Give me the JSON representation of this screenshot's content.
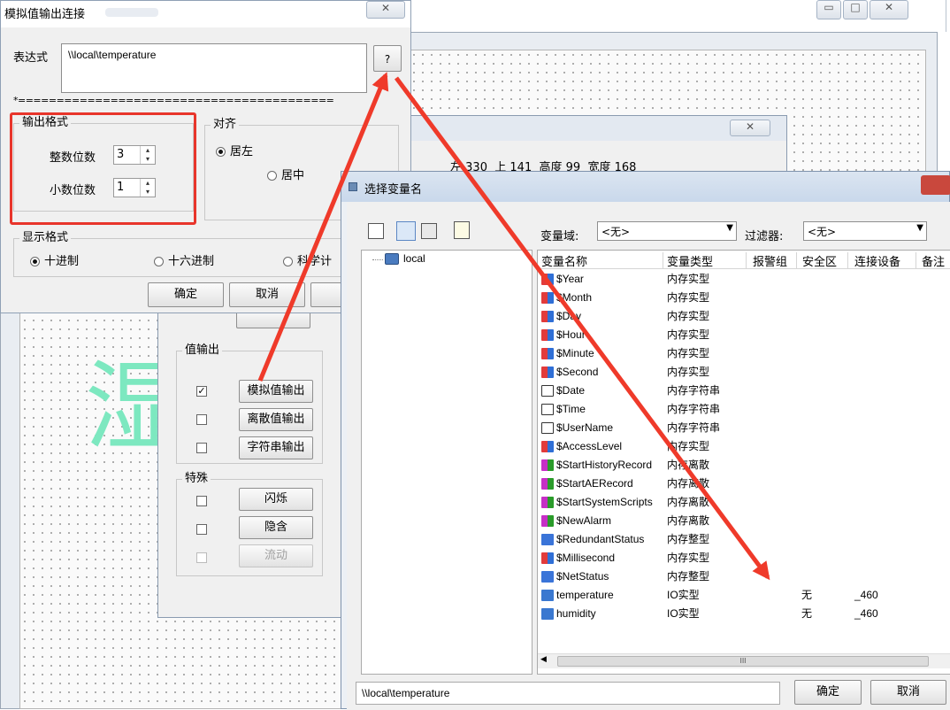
{
  "bg_window": {
    "title_blur": "",
    "buttons": {
      "minimize": "▭",
      "maximize": "□",
      "close": "✕"
    }
  },
  "analog_dialog": {
    "title": "模拟值输出连接",
    "expr_label": "表达式",
    "expr_value": "\\\\local\\temperature",
    "help_btn": "?",
    "separator": "*=========================================",
    "close": "✕",
    "output_format": {
      "title": "输出格式",
      "int_label": "整数位数",
      "int_value": "3",
      "dec_label": "小数位数",
      "dec_value": "1"
    },
    "align": {
      "title": "对齐",
      "left": "居左",
      "center": "居中"
    },
    "display_format": {
      "title": "显示格式",
      "dec": "十进制",
      "hex": "十六进制",
      "sci": "科学计"
    },
    "ok": "确定",
    "cancel": "取消"
  },
  "props_dialog": {
    "close": "✕",
    "coords": {
      "left_label": "左",
      "left": "330",
      "top_label": "上",
      "top": "141",
      "height_label": "高度",
      "height": "99",
      "width_label": "宽度",
      "width": "168"
    },
    "value_output": {
      "title": "值输出",
      "analog": "模拟值输出",
      "discrete": "离散值输出",
      "string": "字符串输出"
    },
    "special": {
      "title": "特殊",
      "blink": "闪烁",
      "hide": "隐含",
      "flow": "流动"
    }
  },
  "canvas_text": "湿",
  "var_dialog": {
    "title": "选择变量名",
    "domain_label": "变量域:",
    "domain_value": "<无>",
    "filter_label": "过滤器:",
    "filter_value": "<无>",
    "tree_root": "local",
    "columns": [
      "变量名称",
      "变量类型",
      "报警组",
      "安全区",
      "连接设备",
      "备注"
    ],
    "rows": [
      {
        "name": "$Year",
        "type": "内存实型",
        "icon": "real",
        "group": "",
        "device": ""
      },
      {
        "name": "$Month",
        "type": "内存实型",
        "icon": "real",
        "group": "",
        "device": ""
      },
      {
        "name": "$Day",
        "type": "内存实型",
        "icon": "real",
        "group": "",
        "device": ""
      },
      {
        "name": "$Hour",
        "type": "内存实型",
        "icon": "real",
        "group": "",
        "device": ""
      },
      {
        "name": "$Minute",
        "type": "内存实型",
        "icon": "real",
        "group": "",
        "device": ""
      },
      {
        "name": "$Second",
        "type": "内存实型",
        "icon": "real",
        "group": "",
        "device": ""
      },
      {
        "name": "$Date",
        "type": "内存字符串",
        "icon": "str",
        "group": "",
        "device": ""
      },
      {
        "name": "$Time",
        "type": "内存字符串",
        "icon": "str",
        "group": "",
        "device": ""
      },
      {
        "name": "$UserName",
        "type": "内存字符串",
        "icon": "str",
        "group": "",
        "device": ""
      },
      {
        "name": "$AccessLevel",
        "type": "内存实型",
        "icon": "real",
        "group": "",
        "device": ""
      },
      {
        "name": "$StartHistoryRecord",
        "type": "内存离散",
        "icon": "disc",
        "group": "",
        "device": ""
      },
      {
        "name": "$StartAERecord",
        "type": "内存离散",
        "icon": "disc",
        "group": "",
        "device": ""
      },
      {
        "name": "$StartSystemScripts",
        "type": "内存离散",
        "icon": "disc",
        "group": "",
        "device": ""
      },
      {
        "name": "$NewAlarm",
        "type": "内存离散",
        "icon": "disc",
        "group": "",
        "device": ""
      },
      {
        "name": "$RedundantStatus",
        "type": "内存整型",
        "icon": "int",
        "group": "",
        "device": ""
      },
      {
        "name": "$Millisecond",
        "type": "内存实型",
        "icon": "real",
        "group": "",
        "device": ""
      },
      {
        "name": "$NetStatus",
        "type": "内存整型",
        "icon": "int",
        "group": "",
        "device": ""
      },
      {
        "name": "temperature",
        "type": "IO实型",
        "icon": "io",
        "group": "无",
        "device": "_460"
      },
      {
        "name": "humidity",
        "type": "IO实型",
        "icon": "io",
        "group": "无",
        "device": "_460"
      }
    ],
    "scroll_mark": "III",
    "path_value": "\\\\local\\temperature",
    "ok": "确定",
    "cancel": "取消"
  },
  "colors": {
    "highlight_box": "#e8352b",
    "arrow": "#ef3a2a",
    "canvas_text": "#7de8c0"
  }
}
